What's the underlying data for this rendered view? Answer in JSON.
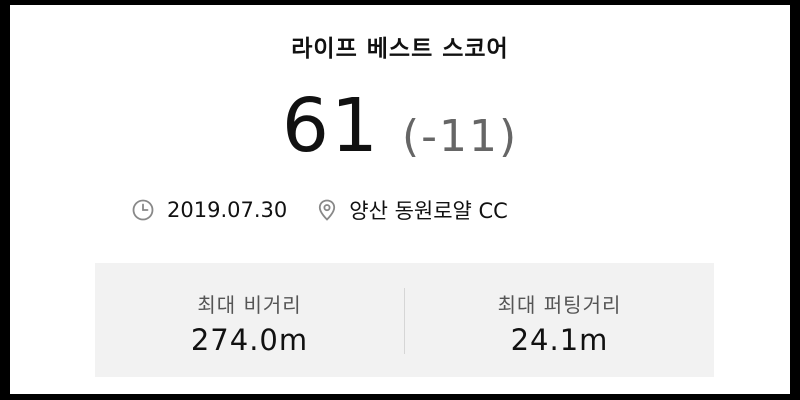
{
  "card": {
    "title": "라이프 베스트 스코어",
    "score": "61",
    "score_diff": "(-11)",
    "date": "2019.07.30",
    "location": "양산 동원로얄 CC",
    "icons": {
      "date": "clock-icon",
      "location": "location-pin-icon"
    }
  },
  "stats": [
    {
      "label": "최대 비거리",
      "value": "274.0m"
    },
    {
      "label": "최대 퍼팅거리",
      "value": "24.1m"
    }
  ],
  "colors": {
    "background": "#000000",
    "card": "#ffffff",
    "primary_text": "#111111",
    "secondary_text": "#666666",
    "stats_box": "#f2f2f2",
    "icon": "#888888"
  }
}
